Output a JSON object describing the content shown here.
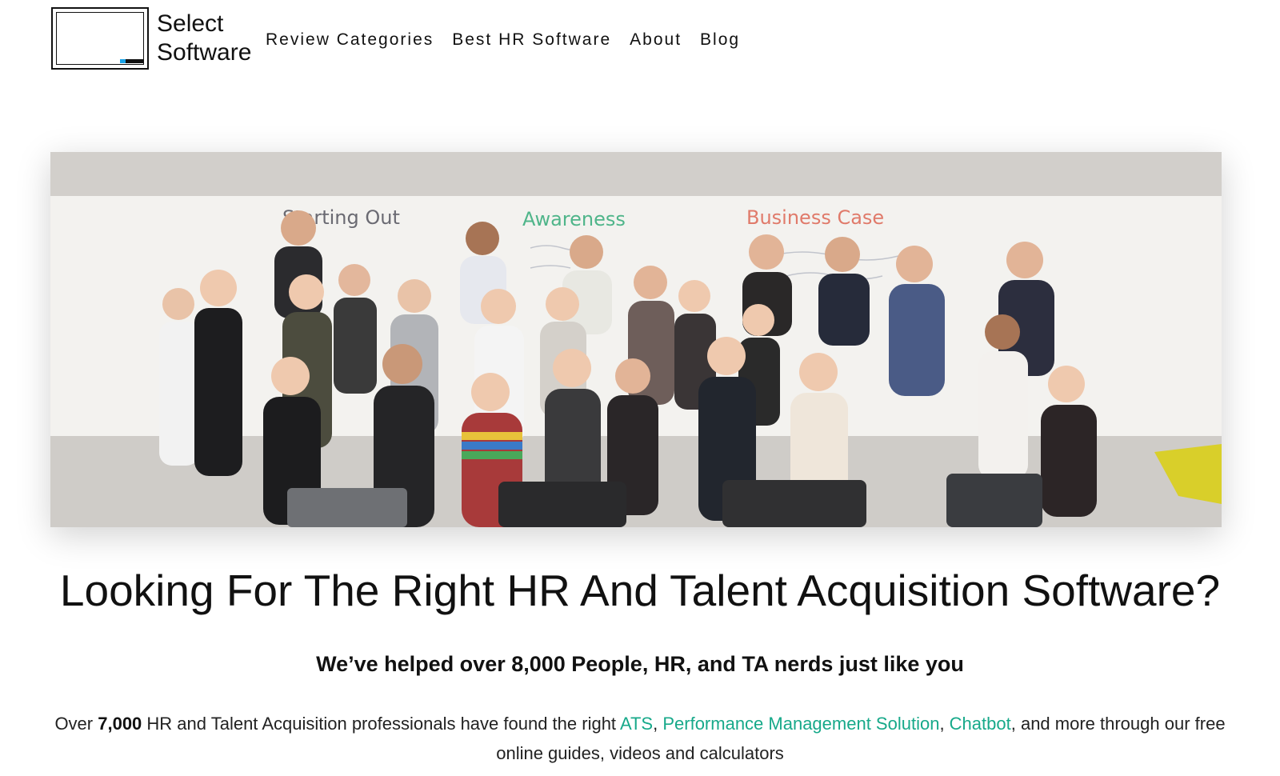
{
  "header": {
    "logo_text_line1": "Select",
    "logo_text_line2": "Software",
    "nav": [
      {
        "label": "Review Categories"
      },
      {
        "label": "Best HR Software"
      },
      {
        "label": "About"
      },
      {
        "label": "Blog"
      }
    ]
  },
  "hero": {
    "whiteboard_headings": [
      "Starting Out",
      "Awareness",
      "Business Case"
    ]
  },
  "main": {
    "headline": "Looking For The Right HR And Talent Acquisition Software?",
    "subheadline": "We’ve helped over 8,000 People, HR, and TA nerds just like you",
    "body": {
      "prefix": "Over ",
      "count": "7,000",
      "middle": " HR and Talent Acquisition professionals have found the right ",
      "link_ats": "ATS",
      "sep1": ", ",
      "link_pms": "Performance Management Solution",
      "sep2": ", ",
      "link_chatbot": "Chatbot",
      "suffix": ", and more through our free online guides, videos and calculators"
    }
  },
  "colors": {
    "link": "#17a98a",
    "logo_accent": "#1aa3e8",
    "text": "#111111"
  }
}
